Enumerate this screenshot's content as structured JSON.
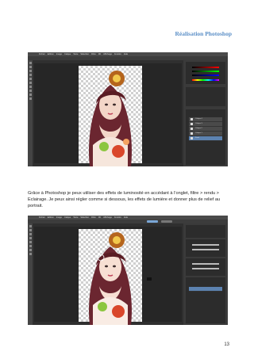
{
  "header": {
    "title": "Réalisation Photoshop"
  },
  "screenshot_top": {
    "menu": [
      "Fichier",
      "Edition",
      "Image",
      "Calque",
      "Texte",
      "Sélection",
      "Filtre",
      "3D",
      "Affichage",
      "Fenêtre",
      "Aide"
    ],
    "layers": [
      "Calque 4",
      "Calque 3",
      "Calque 2",
      "Calque 1",
      "Fond"
    ]
  },
  "body": {
    "paragraph": "Grâce à Photoshop je peux utiliser des effets de luminosité en accédant à l’onglet, filtre > rendu > Eclairage. Je peux ainsi régler comme si dessous, les effets de lumière et donner plus de relief au portrait."
  },
  "screenshot_bottom": {
    "menu": [
      "Fichier",
      "Edition",
      "Image",
      "Calque",
      "Texte",
      "Sélection",
      "Filtre",
      "3D",
      "Affichage",
      "Fenêtre",
      "Aide"
    ]
  },
  "footer": {
    "page_number": "13"
  }
}
